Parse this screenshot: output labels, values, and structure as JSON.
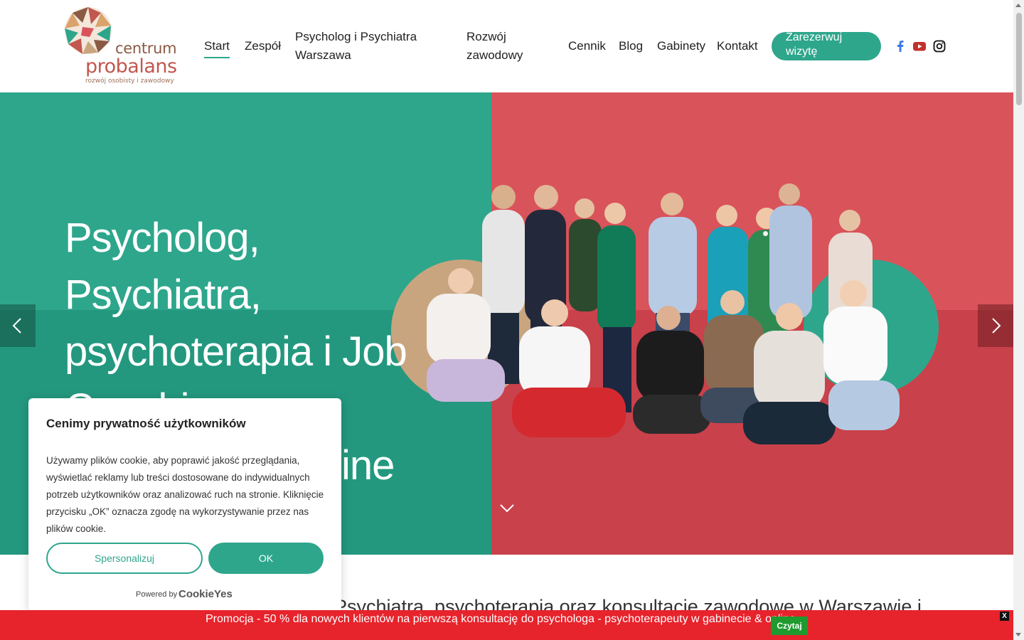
{
  "logo": {
    "word1": "centrum",
    "word2": "probalans",
    "tagline": "rozwój osobisty i zawodowy"
  },
  "nav": {
    "items": [
      {
        "label": "Start",
        "active": true
      },
      {
        "label": "Zespół"
      },
      {
        "label": "Psycholog i Psychiatra Warszawa"
      },
      {
        "label": "Rozwój zawodowy"
      },
      {
        "label": "Cennik"
      },
      {
        "label": "Blog"
      },
      {
        "label": "Gabinety"
      },
      {
        "label": "Kontakt"
      }
    ],
    "cta": "Zarezerwuj wizytę"
  },
  "social": [
    "facebook-icon",
    "youtube-icon",
    "instagram-icon"
  ],
  "hero": {
    "title": "Psycholog, Psychiatra, psychoterapia i Job Coaching w Warszawie i online"
  },
  "sub_heading": "Psychiatra, psychoterapia oraz konsultacje zawodowe w Warszawie i",
  "cookie": {
    "title": "Cenimy prywatność użytkowników",
    "text": "Używamy plików cookie, aby poprawić jakość przeglądania, wyświetlać reklamy lub treści dostosowane do indywidualnych potrzeb użytkowników oraz analizować ruch na stronie. Kliknięcie przycisku „OK” oznacza zgodę na wykorzystywanie przez nas plików cookie.",
    "customize": "Spersonalizuj",
    "ok": "OK",
    "powered_by": "Powered by",
    "brand": "CookieYes"
  },
  "promo": {
    "text": "Promocja - 50 % dla nowych klientów na pierwszą  konsultację do psychologa - psychoterapeuty w gabinecie & online.",
    "button": "Czytaj",
    "close": "X"
  },
  "colors": {
    "accent": "#2ea68c",
    "hero_red": "#d9535a",
    "promo_red": "#e7232c",
    "promo_btn": "#1f9a2e"
  }
}
